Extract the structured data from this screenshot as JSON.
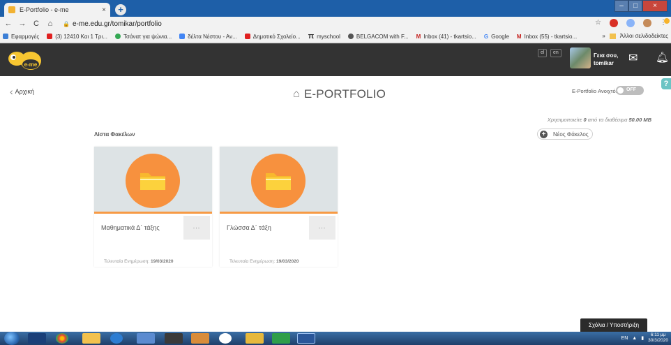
{
  "browser": {
    "tab_title": "E-Portfolio - e-me",
    "tab_close": "×",
    "new_tab": "+",
    "window_controls": [
      "–",
      "□",
      "×"
    ],
    "nav": {
      "back": "←",
      "forward": "→",
      "reload": "C",
      "home": "⌂"
    },
    "url": "e-me.edu.gr/tomikar/portfolio",
    "toolbar_icons": [
      "star-icon",
      "extension-icon",
      "menu-icon"
    ],
    "bookmarks": [
      {
        "label": "Εφαρμογές",
        "color": "#3c7fd6"
      },
      {
        "label": "(3) 12410 Και 1 Τρι...",
        "color": "#e02020"
      },
      {
        "label": "Τσάνατ για ψώνια...",
        "color": "#34a853"
      },
      {
        "label": "δέλτα Νέστου - Αν...",
        "color": "#4285f4"
      },
      {
        "label": "Δημοτικό Σχολείο...",
        "color": "#e02020"
      },
      {
        "label": "myschool",
        "color": "#333333"
      },
      {
        "label": "BELGACOM with F...",
        "color": "#555555"
      },
      {
        "label": "Inbox (41) - tkartsio...",
        "color": "#c5221f"
      },
      {
        "label": "Google",
        "color": "#4285f4"
      },
      {
        "label": "Inbox (55) - tkartsio...",
        "color": "#c5221f"
      }
    ],
    "bookmarks_overflow": "»",
    "other_bookmarks": "Άλλοι σελιδοδείκτες"
  },
  "header": {
    "logo_text": "e-me",
    "lang_el": "el",
    "lang_en": "en",
    "greeting_line1": "Γεια σου,",
    "greeting_line2": "tomikar",
    "help_label": "?"
  },
  "page": {
    "back_label": "Αρχική",
    "title": "E-PORTFOLIO",
    "open_toggle_label": "E-Portfolio Ανοιχτό:",
    "toggle_state": "OFF",
    "usage_prefix": "Χρησιμοποιείτε ",
    "usage_used": "0",
    "usage_mid": " από τα διαθέσιμα ",
    "usage_total": "50.00 MB",
    "new_folder_label": "Νέος Φάκελος",
    "section_label": "Λίστα Φακέλων"
  },
  "folders": [
    {
      "name": "Μαθηματικά Δ΄ τάξης",
      "menu": "...",
      "updated_label": "Τελευταία Ενημέρωση:",
      "updated_date": "19/03/2020"
    },
    {
      "name": "Γλώσσα Δ΄ τάξη",
      "menu": "...",
      "updated_label": "Τελευταία Ενημέρωση:",
      "updated_date": "19/03/2020"
    }
  ],
  "feedback_label": "Σχόλια / Υποστήριξη",
  "taskbar": {
    "apps": [
      "ie-icon",
      "media-icon",
      "chrome-icon",
      "folder-icon",
      "edge-icon",
      "paint-icon",
      "app-icon",
      "app-icon",
      "app-icon",
      "app-icon",
      "app-icon",
      "word-icon"
    ],
    "lang": "EN",
    "time": "6:11 μμ",
    "date": "30/3/2020"
  },
  "colors": {
    "header_bg": "#333333",
    "accent_orange": "#f7913e",
    "card_thumb_bg": "#dde3e5",
    "toggle_off": "#bdbdbd"
  }
}
